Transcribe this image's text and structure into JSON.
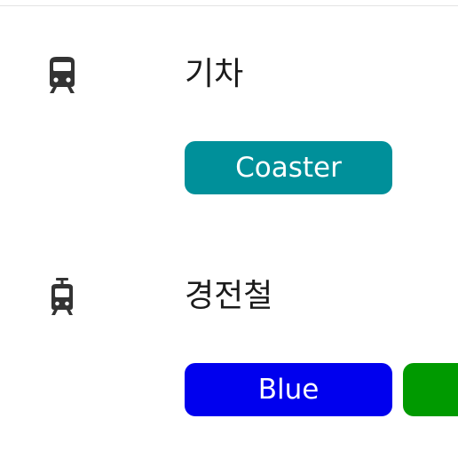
{
  "sections": [
    {
      "icon": "train-icon",
      "mode_label": "기차",
      "routes": [
        {
          "label": "Coaster",
          "color": "#00909a"
        }
      ]
    },
    {
      "icon": "light-rail-icon",
      "mode_label": "경전철",
      "routes": [
        {
          "label": "Blue",
          "color": "#0000ee"
        },
        {
          "label": "",
          "color": "#009a00"
        }
      ]
    }
  ]
}
